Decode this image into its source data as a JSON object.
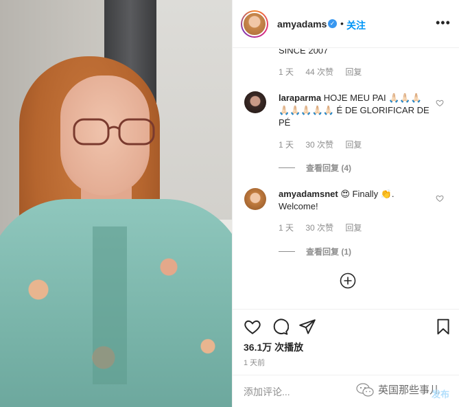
{
  "header": {
    "username": "amyadams",
    "separator": "•",
    "follow_label": "关注",
    "more_label": "•••"
  },
  "comments": [
    {
      "text": "SINCE 2007",
      "time": "1 天",
      "likes": "44 次赞",
      "reply_label": "回复"
    },
    {
      "username": "laraparma",
      "text": "HOJE MEU PAI 🙏🏻🙏🏻🙏🏻🙏🏻🙏🏻🙏🏻🙏🏻🙏🏻 É DE GLORIFICAR DE PÉ",
      "time": "1 天",
      "likes": "30 次赞",
      "reply_label": "回复",
      "view_replies": "查看回复 (4)"
    },
    {
      "username": "amyadamsnet",
      "text": "😍 Finally 👏. Welcome!",
      "time": "1 天",
      "likes": "30 次赞",
      "reply_label": "回复",
      "view_replies": "查看回复 (1)"
    }
  ],
  "stats": {
    "plays": "36.1万 次播放",
    "posted_ago": "1 天前"
  },
  "comment_box": {
    "placeholder": "添加评论...",
    "post_label": "发布"
  },
  "watermark": {
    "text": "英国那些事儿"
  },
  "colors": {
    "link_blue": "#0095f6",
    "verified_blue": "#3897f0",
    "muted_gray": "#8e8e8e",
    "post_disabled": "#b2dffc"
  },
  "icons": [
    "verified-badge-icon",
    "more-options-icon",
    "heart-icon",
    "comment-icon",
    "share-icon",
    "bookmark-icon",
    "plus-circle-icon",
    "wechat-icon"
  ]
}
